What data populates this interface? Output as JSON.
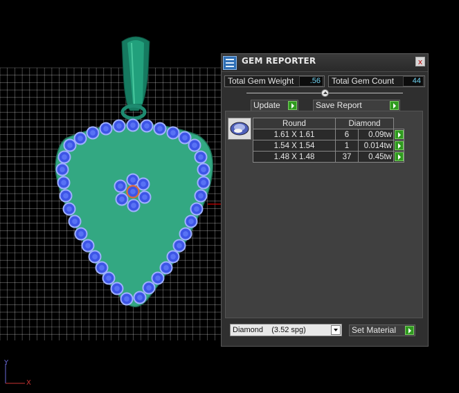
{
  "panel": {
    "title": "GEM REPORTER",
    "close_label": "x",
    "total_weight_label": "Total Gem Weight",
    "total_weight_value": ".56",
    "total_count_label": "Total Gem Count",
    "total_count_value": "44",
    "update_label": "Update",
    "save_report_label": "Save Report",
    "table": {
      "headers": [
        "Round",
        "Diamond"
      ],
      "rows": [
        {
          "size": "1.61 X 1.61",
          "count": "6",
          "weight": "0.09tw"
        },
        {
          "size": "1.54 X 1.54",
          "count": "1",
          "weight": "0.014tw"
        },
        {
          "size": "1.48 X 1.48",
          "count": "37",
          "weight": "0.45tw"
        }
      ]
    },
    "material_value": "Diamond    (3.52 spg)",
    "set_material_label": "Set Material"
  },
  "axis": {
    "y": "Y",
    "x": "X"
  },
  "colors": {
    "grid": "#ffffff",
    "pendant_fill": "#33a882",
    "bail": "#1e8a70",
    "gem_fill": "#3d55e6",
    "gem_ring": "#9fb0ff",
    "axis_red": "#d00000",
    "accent_green": "#2f9a1f"
  }
}
